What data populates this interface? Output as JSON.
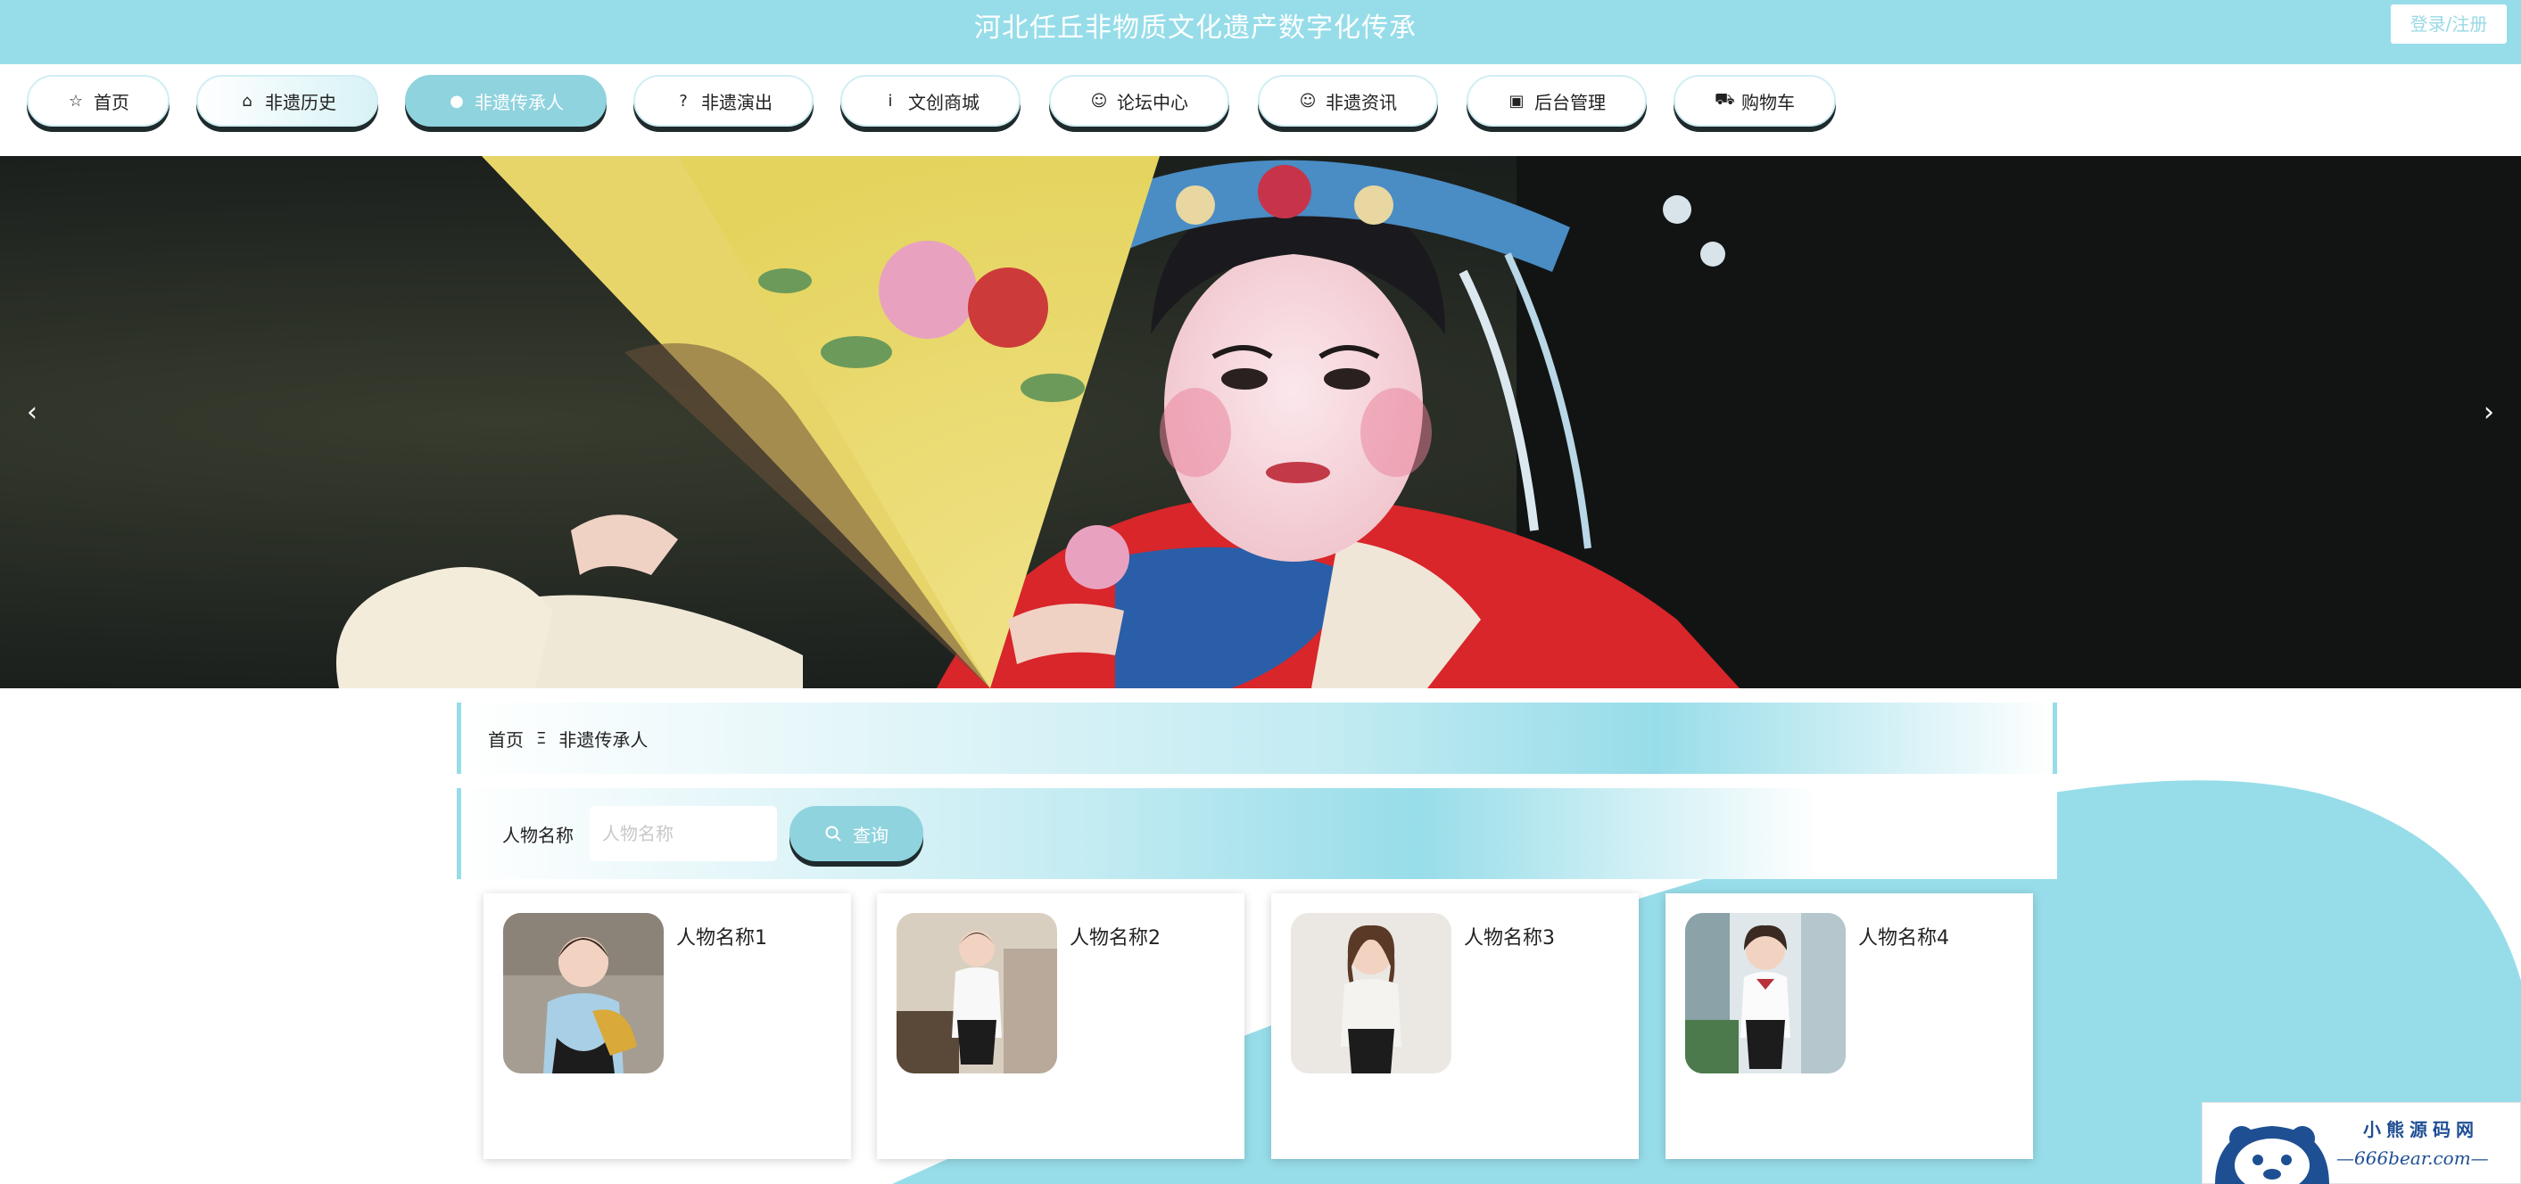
{
  "header": {
    "site_title": "河北任丘非物质文化遗产数字化传承",
    "login_label": "登录/注册"
  },
  "nav": [
    {
      "label": "首页",
      "icon": "star-icon",
      "glyph": "☆"
    },
    {
      "label": "非遗历史",
      "icon": "bag-icon",
      "glyph": "⌂"
    },
    {
      "label": "非遗传承人",
      "icon": "info-icon",
      "glyph": "●"
    },
    {
      "label": "非遗演出",
      "icon": "question-icon",
      "glyph": "?"
    },
    {
      "label": "文创商城",
      "icon": "info-circle-icon",
      "glyph": "i"
    },
    {
      "label": "论坛中心",
      "icon": "smile-icon",
      "glyph": "☺"
    },
    {
      "label": "非遗资讯",
      "icon": "face-icon",
      "glyph": "☺"
    },
    {
      "label": "后台管理",
      "icon": "briefcase-icon",
      "glyph": "▣"
    },
    {
      "label": "购物车",
      "icon": "cart-icon",
      "glyph": "⛟"
    }
  ],
  "banner": {
    "prev_glyph": "‹",
    "next_glyph": "›"
  },
  "breadcrumb": {
    "home": "首页",
    "separator": "Ξ",
    "current": "非遗传承人"
  },
  "search": {
    "label": "人物名称",
    "placeholder": "人物名称",
    "value": "",
    "button_label": "查询"
  },
  "cards": [
    {
      "name": "人物名称1"
    },
    {
      "name": "人物名称2"
    },
    {
      "name": "人物名称3"
    },
    {
      "name": "人物名称4"
    }
  ],
  "watermark": {
    "title": "小熊源码网",
    "url": "—666bear.com—"
  },
  "colors": {
    "accent": "#97dde9",
    "active_nav": "#8fd3de",
    "shadow": "#1e2a2c"
  }
}
